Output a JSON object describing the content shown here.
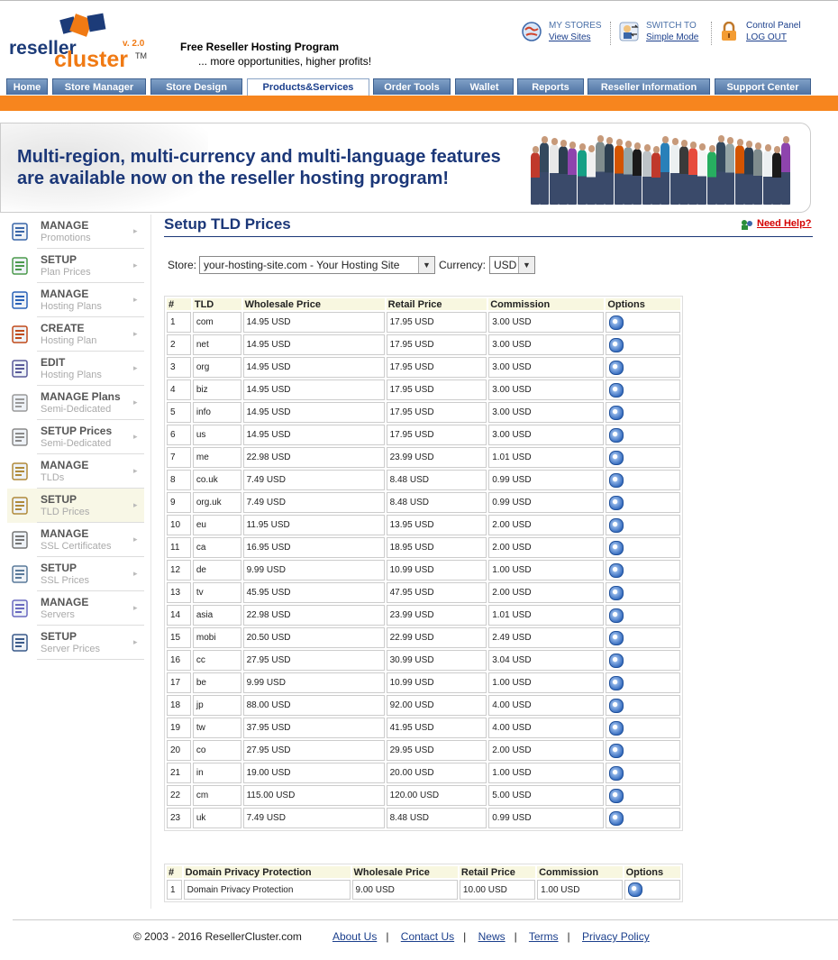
{
  "header": {
    "logo_reseller": "reseller",
    "logo_cluster": "cluster",
    "logo_version": "v. 2.0",
    "logo_tm": "TM",
    "slogan_main": "Free Reseller Hosting Program",
    "slogan_sub": "... more opportunities, higher profits!",
    "my_stores_label": "MY STORES",
    "my_stores_link": "View Sites",
    "switch_label": "SWITCH TO",
    "switch_link": "Simple Mode",
    "cp_label": "Control Panel",
    "cp_link": "LOG OUT"
  },
  "nav": {
    "tabs": [
      "Home",
      "Store Manager",
      "Store Design",
      "Products&Services",
      "Order Tools",
      "Wallet",
      "Reports",
      "Reseller Information",
      "Support Center"
    ],
    "active": "Products&Services"
  },
  "banner": {
    "line1": "Multi-region, multi-currency and multi-language features",
    "line2": "are available now on the reseller hosting program!"
  },
  "sidebar": {
    "items": [
      {
        "title": "MANAGE",
        "sub": "Promotions",
        "icon": "sale-tag-icon"
      },
      {
        "title": "SETUP",
        "sub": "Plan Prices",
        "icon": "money-icon"
      },
      {
        "title": "MANAGE",
        "sub": "Hosting Plans",
        "icon": "window-icon"
      },
      {
        "title": "CREATE",
        "sub": "Hosting Plan",
        "icon": "pencil-icon"
      },
      {
        "title": "EDIT",
        "sub": "Hosting Plans",
        "icon": "edit-clipboard-icon"
      },
      {
        "title": "MANAGE Plans",
        "sub": "Semi-Dedicated",
        "icon": "server-tower-icon"
      },
      {
        "title": "SETUP Prices",
        "sub": "Semi-Dedicated",
        "icon": "server-stack-icon"
      },
      {
        "title": "MANAGE",
        "sub": "TLDs",
        "icon": "document-icon"
      },
      {
        "title": "SETUP",
        "sub": "TLD Prices",
        "icon": "price-list-icon"
      },
      {
        "title": "MANAGE",
        "sub": "SSL Certificates",
        "icon": "ssl-lock-icon"
      },
      {
        "title": "SETUP",
        "sub": "SSL Prices",
        "icon": "ssl-price-icon"
      },
      {
        "title": "MANAGE",
        "sub": "Servers",
        "icon": "server-icon"
      },
      {
        "title": "SETUP",
        "sub": "Server Prices",
        "icon": "calculator-icon"
      }
    ],
    "arrow": "▸"
  },
  "page": {
    "title": "Setup TLD Prices",
    "help": "Need Help?",
    "store_label": "Store:",
    "store_value": "your-hosting-site.com - Your Hosting Site",
    "currency_label": "Currency:",
    "currency_value": "USD",
    "dropdown_glyph": "▼"
  },
  "tld_table": {
    "headers": [
      "#",
      "TLD",
      "Wholesale Price",
      "Retail Price",
      "Commission",
      "Options"
    ],
    "rows": [
      [
        "1",
        "com",
        "14.95 USD",
        "17.95 USD",
        "3.00 USD"
      ],
      [
        "2",
        "net",
        "14.95 USD",
        "17.95 USD",
        "3.00 USD"
      ],
      [
        "3",
        "org",
        "14.95 USD",
        "17.95 USD",
        "3.00 USD"
      ],
      [
        "4",
        "biz",
        "14.95 USD",
        "17.95 USD",
        "3.00 USD"
      ],
      [
        "5",
        "info",
        "14.95 USD",
        "17.95 USD",
        "3.00 USD"
      ],
      [
        "6",
        "us",
        "14.95 USD",
        "17.95 USD",
        "3.00 USD"
      ],
      [
        "7",
        "me",
        "22.98 USD",
        "23.99 USD",
        "1.01 USD"
      ],
      [
        "8",
        "co.uk",
        "7.49 USD",
        "8.48 USD",
        "0.99 USD"
      ],
      [
        "9",
        "org.uk",
        "7.49 USD",
        "8.48 USD",
        "0.99 USD"
      ],
      [
        "10",
        "eu",
        "11.95 USD",
        "13.95 USD",
        "2.00 USD"
      ],
      [
        "11",
        "ca",
        "16.95 USD",
        "18.95 USD",
        "2.00 USD"
      ],
      [
        "12",
        "de",
        "9.99 USD",
        "10.99 USD",
        "1.00 USD"
      ],
      [
        "13",
        "tv",
        "45.95 USD",
        "47.95 USD",
        "2.00 USD"
      ],
      [
        "14",
        "asia",
        "22.98 USD",
        "23.99 USD",
        "1.01 USD"
      ],
      [
        "15",
        "mobi",
        "20.50 USD",
        "22.99 USD",
        "2.49 USD"
      ],
      [
        "16",
        "cc",
        "27.95 USD",
        "30.99 USD",
        "3.04 USD"
      ],
      [
        "17",
        "be",
        "9.99 USD",
        "10.99 USD",
        "1.00 USD"
      ],
      [
        "18",
        "jp",
        "88.00 USD",
        "92.00 USD",
        "4.00 USD"
      ],
      [
        "19",
        "tw",
        "37.95 USD",
        "41.95 USD",
        "4.00 USD"
      ],
      [
        "20",
        "co",
        "27.95 USD",
        "29.95 USD",
        "2.00 USD"
      ],
      [
        "21",
        "in",
        "19.00 USD",
        "20.00 USD",
        "1.00 USD"
      ],
      [
        "22",
        "cm",
        "115.00 USD",
        "120.00 USD",
        "5.00 USD"
      ],
      [
        "23",
        "uk",
        "7.49 USD",
        "8.48 USD",
        "0.99 USD"
      ]
    ]
  },
  "privacy_table": {
    "headers": [
      "#",
      "Domain Privacy Protection",
      "Wholesale Price",
      "Retail Price",
      "Commission",
      "Options"
    ],
    "rows": [
      [
        "1",
        "Domain Privacy Protection",
        "9.00 USD",
        "10.00 USD",
        "1.00 USD"
      ]
    ]
  },
  "footer": {
    "copyright": "© 2003 - 2016 ResellerCluster.com",
    "links": [
      "About Us",
      "Contact Us",
      "News",
      "Terms",
      "Privacy Policy"
    ],
    "separator": "|"
  }
}
